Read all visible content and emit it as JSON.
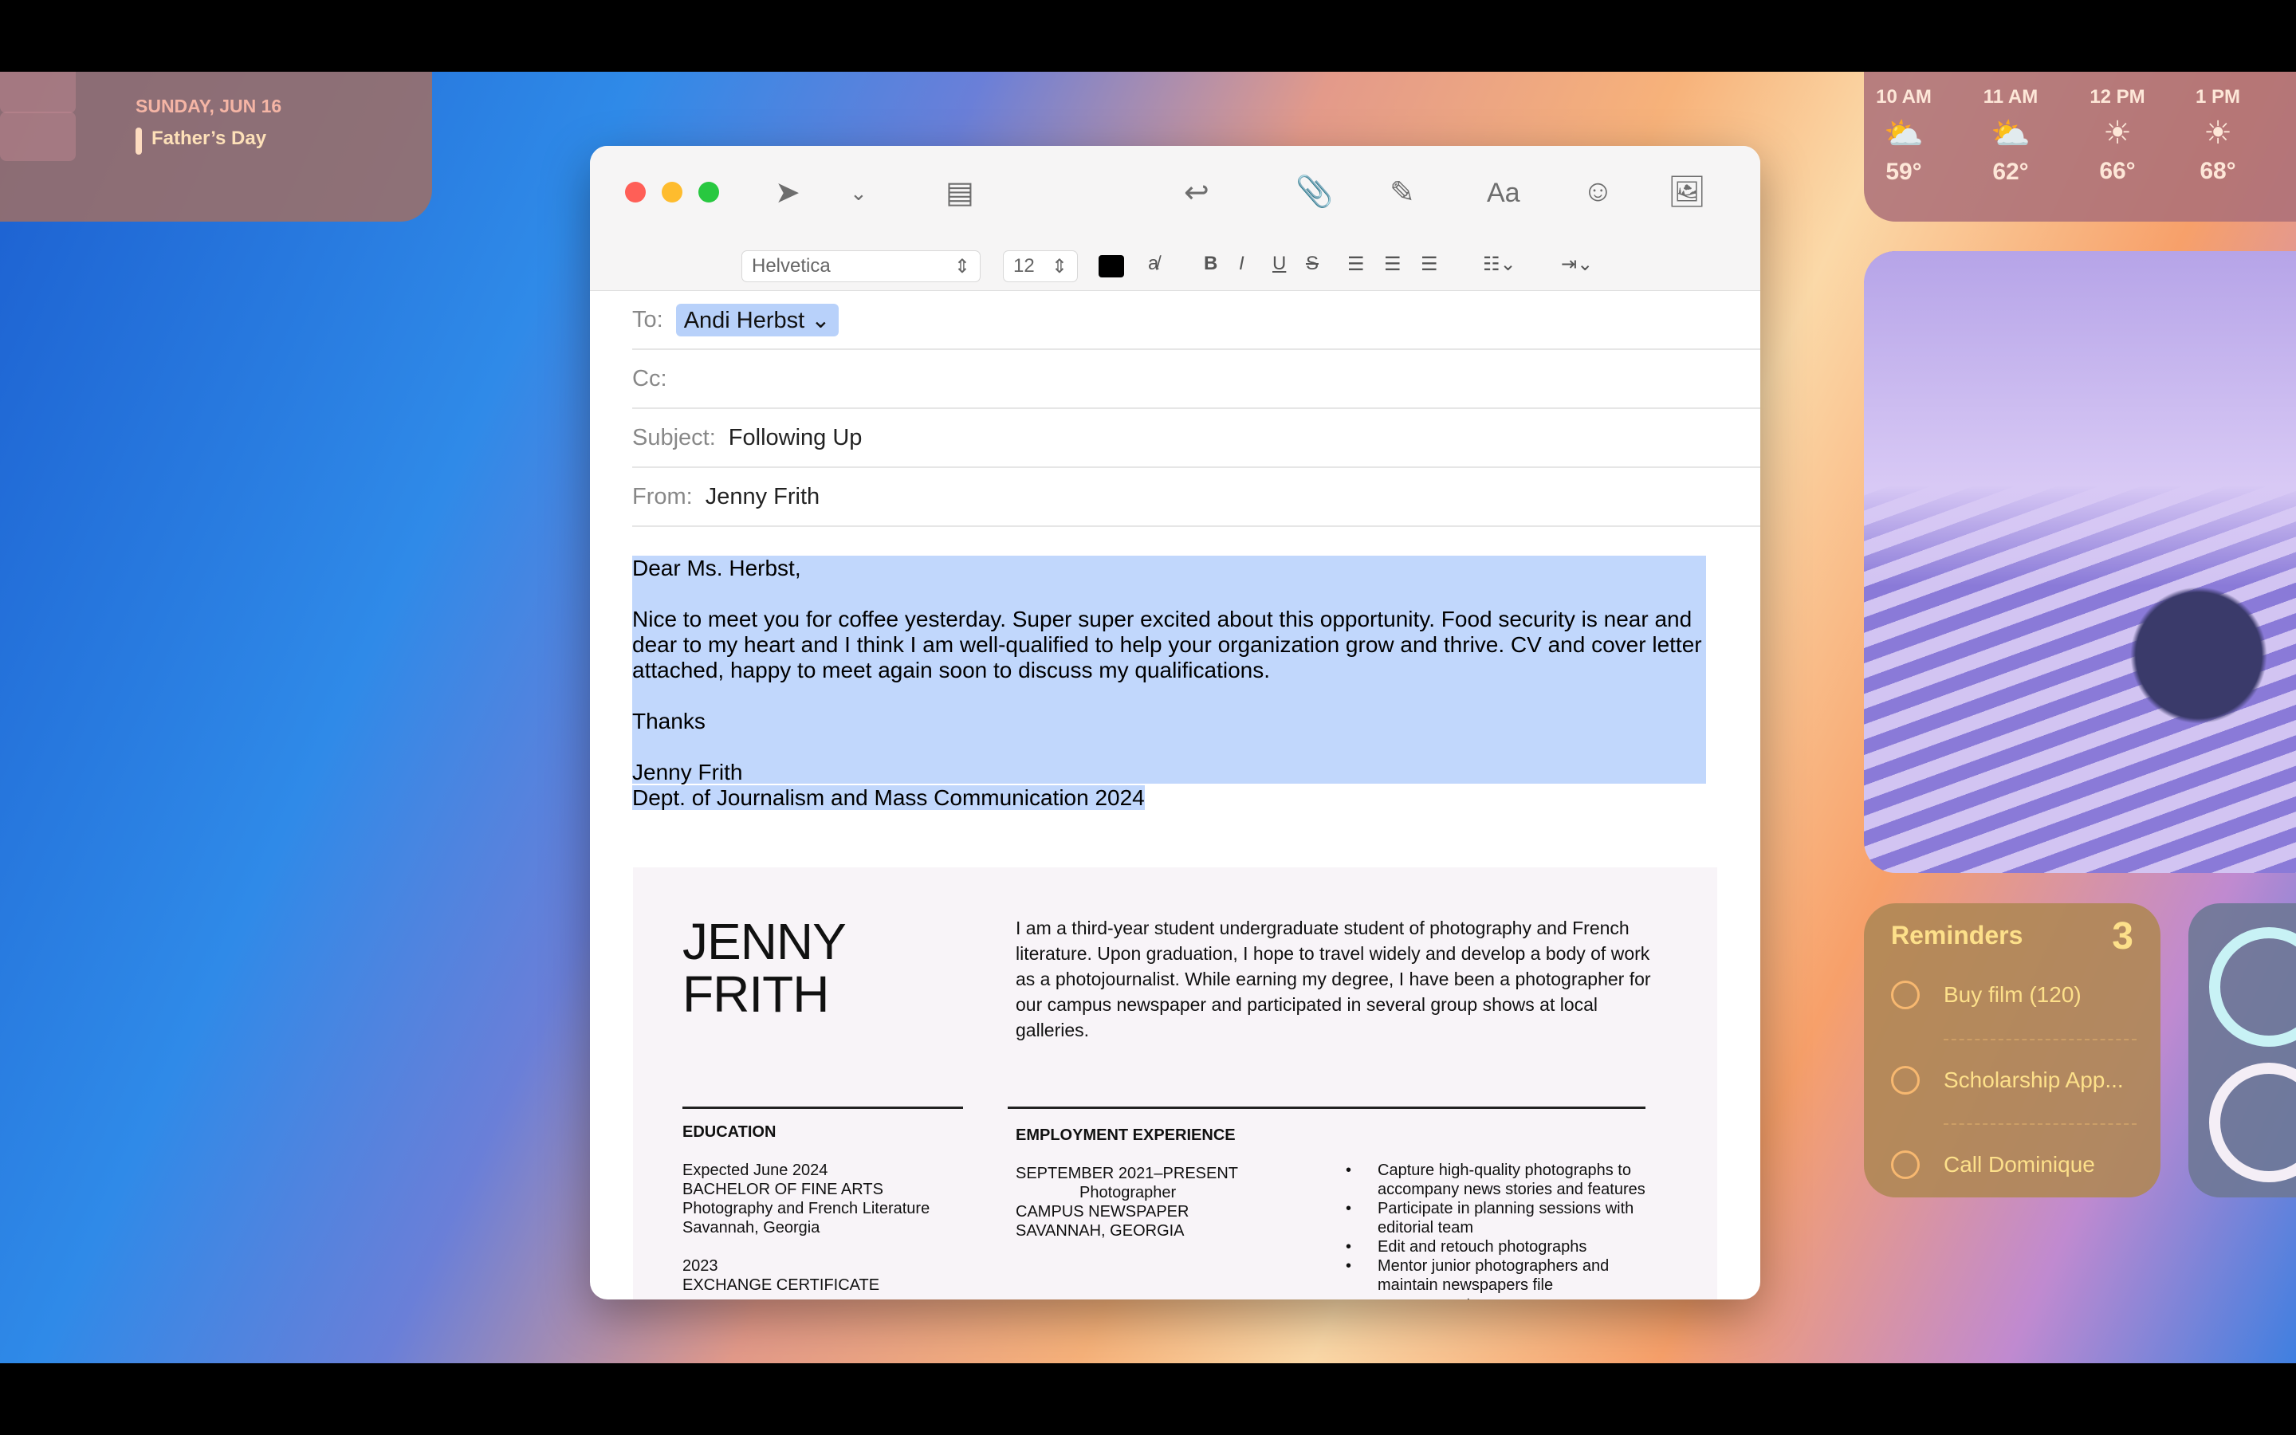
{
  "calendar": {
    "date": "SUNDAY, JUN 16",
    "event": "Father’s Day"
  },
  "weather": [
    {
      "time": "10 AM",
      "icon": "partly-cloudy-icon",
      "temp": "59°"
    },
    {
      "time": "11 AM",
      "icon": "partly-cloudy-icon",
      "temp": "62°"
    },
    {
      "time": "12 PM",
      "icon": "sun-icon",
      "temp": "66°"
    },
    {
      "time": "1 PM",
      "icon": "sun-icon",
      "temp": "68°"
    }
  ],
  "reminders": {
    "title": "Reminders",
    "count": "3",
    "items": [
      "Buy film (120)",
      "Scholarship App...",
      "Call Dominique"
    ]
  },
  "batteries": {
    "devices": [
      "laptop-icon",
      "mouse-icon"
    ]
  },
  "format": {
    "font": "Helvetica",
    "size": "12"
  },
  "header": {
    "to_label": "To:",
    "to": "Andi Herbst",
    "cc_label": "Cc:",
    "subject_label": "Subject:",
    "subject": "Following Up",
    "from_label": "From:",
    "from": "Jenny Frith"
  },
  "body": {
    "greeting": "Dear Ms. Herbst,",
    "para": "Nice to meet you for coffee yesterday. Super super excited about this opportunity. Food security is near and dear to my heart and I think I am well-qualified to help your organization grow and thrive. CV and cover letter attached, happy to meet again soon to discuss my qualifications.",
    "thanks": "Thanks",
    "name": "Jenny Frith",
    "dept": "Dept. of Journalism and Mass Communication 2024"
  },
  "resume": {
    "name1": "JENNY",
    "name2": "FRITH",
    "bio": "I am a third-year student undergraduate student of photography and French literature. Upon graduation, I hope to travel widely and develop a body of work as a photojournalist. While earning my degree, I have been a photographer for our campus newspaper and participated in several group shows at local galleries.",
    "edu_title": "EDUCATION",
    "edu": [
      "Expected June 2024",
      "BACHELOR OF FINE ARTS",
      "Photography and French Literature",
      "Savannah, Georgia"
    ],
    "edu2": [
      "2023",
      "EXCHANGE CERTIFICATE"
    ],
    "emp_title": "EMPLOYMENT EXPERIENCE",
    "emp": [
      "SEPTEMBER 2021–PRESENT",
      "Photographer",
      "CAMPUS NEWSPAPER",
      "SAVANNAH, GEORGIA"
    ],
    "bullets": [
      "Capture high-quality photographs to accompany news stories and features",
      "Participate in planning sessions with editorial team",
      "Edit and retouch photographs",
      "Mentor junior photographers and maintain newspapers file management"
    ]
  },
  "colors": {
    "accent": "#c1d7fc",
    "close": "#ff5f57",
    "minimize": "#febc2e",
    "zoom": "#28c840"
  }
}
